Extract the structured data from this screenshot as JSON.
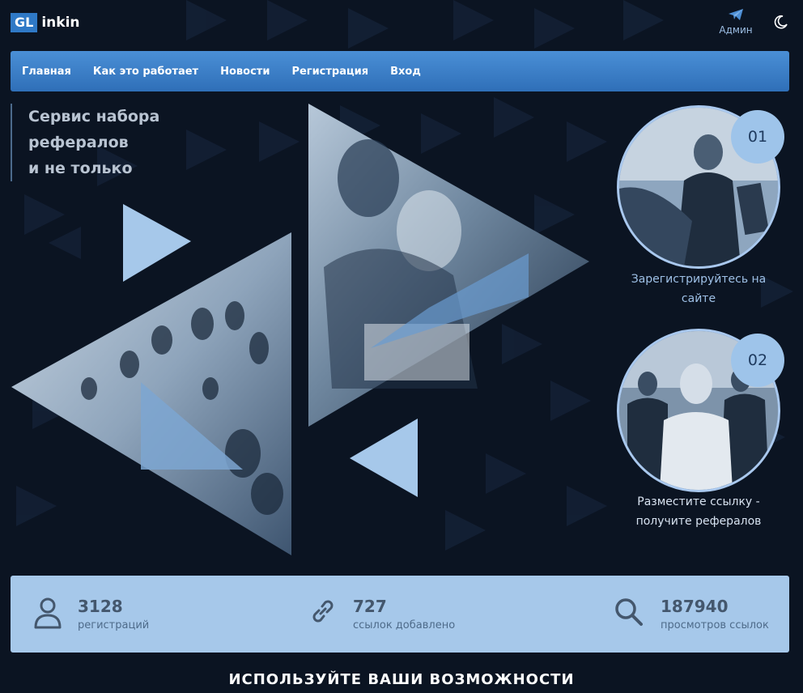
{
  "logo": {
    "box": "GL",
    "text": "inkin"
  },
  "header": {
    "admin_label": "Админ",
    "admin_icon": "paper-plane-icon",
    "theme_icon": "moon-icon"
  },
  "nav": {
    "items": [
      {
        "label": "Главная"
      },
      {
        "label": "Как это работает"
      },
      {
        "label": "Новости"
      },
      {
        "label": "Регистрация"
      },
      {
        "label": "Вход"
      }
    ]
  },
  "hero": {
    "lines": [
      "Сервис набора",
      "рефералов",
      "и не только"
    ]
  },
  "steps": [
    {
      "number": "01",
      "caption_lines": [
        "Зарегистрируйтесь на",
        "сайте"
      ],
      "caption_color": "#9ec0e6"
    },
    {
      "number": "02",
      "caption_lines": [
        "Разместите ссылку -",
        "получите рефералов"
      ],
      "caption_color": "#d7e2f0"
    }
  ],
  "stats": [
    {
      "value": "3128",
      "label": "регистраций",
      "icon": "user-icon"
    },
    {
      "value": "727",
      "label": "ссылок добавлено",
      "icon": "link-icon"
    },
    {
      "value": "187940",
      "label": "просмотров ссылок",
      "icon": "search-icon"
    }
  ],
  "section": {
    "heading": "ИСПОЛЬЗУЙТЕ ВАШИ ВОЗМОЖНОСТИ"
  },
  "colors": {
    "background": "#0b1422",
    "accent": "#2f79c6",
    "light_blue": "#a6c8ea"
  }
}
